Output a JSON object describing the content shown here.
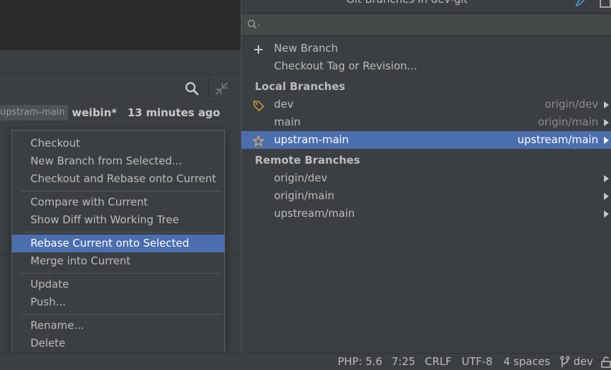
{
  "colors": {
    "editor_bg": "#2b2b2b",
    "panel_bg": "#3c3f41",
    "selection": "#4b6eaf",
    "tag_icon": "#d79a46",
    "star_icon": "#e4b24a",
    "header_icon_blue": "#4a9fd6"
  },
  "log": {
    "branch_tag": "upstram-main",
    "author": "weibin*",
    "time": "13 minutes ago"
  },
  "context_menu": {
    "items": [
      "Checkout",
      "New Branch from Selected...",
      "Checkout and Rebase onto Current",
      "Compare with Current",
      "Show Diff with Working Tree",
      "Rebase Current onto Selected",
      "Merge into Current",
      "Update",
      "Push...",
      "Rename...",
      "Delete"
    ],
    "selected": "Rebase Current onto Selected"
  },
  "branches_popup": {
    "title": "Git Branches in dev-git",
    "search_value": "",
    "actions": [
      {
        "label": "New Branch",
        "icon": "plus-icon"
      },
      {
        "label": "Checkout Tag or Revision...",
        "icon": ""
      }
    ],
    "local_header": "Local Branches",
    "local": [
      {
        "name": "dev",
        "tracking": "origin/dev",
        "icon": "tag-icon"
      },
      {
        "name": "main",
        "tracking": "origin/main",
        "icon": ""
      },
      {
        "name": "upstram-main",
        "tracking": "upstream/main",
        "icon": "star-icon",
        "selected": true
      }
    ],
    "remote_header": "Remote Branches",
    "remote": [
      {
        "name": "origin/dev"
      },
      {
        "name": "origin/main"
      },
      {
        "name": "upstream/main"
      }
    ]
  },
  "status_bar": {
    "php": "PHP: 5.6",
    "position": "7:25",
    "line_sep": "CRLF",
    "encoding": "UTF-8",
    "indent": "4 spaces",
    "branch": "dev"
  }
}
